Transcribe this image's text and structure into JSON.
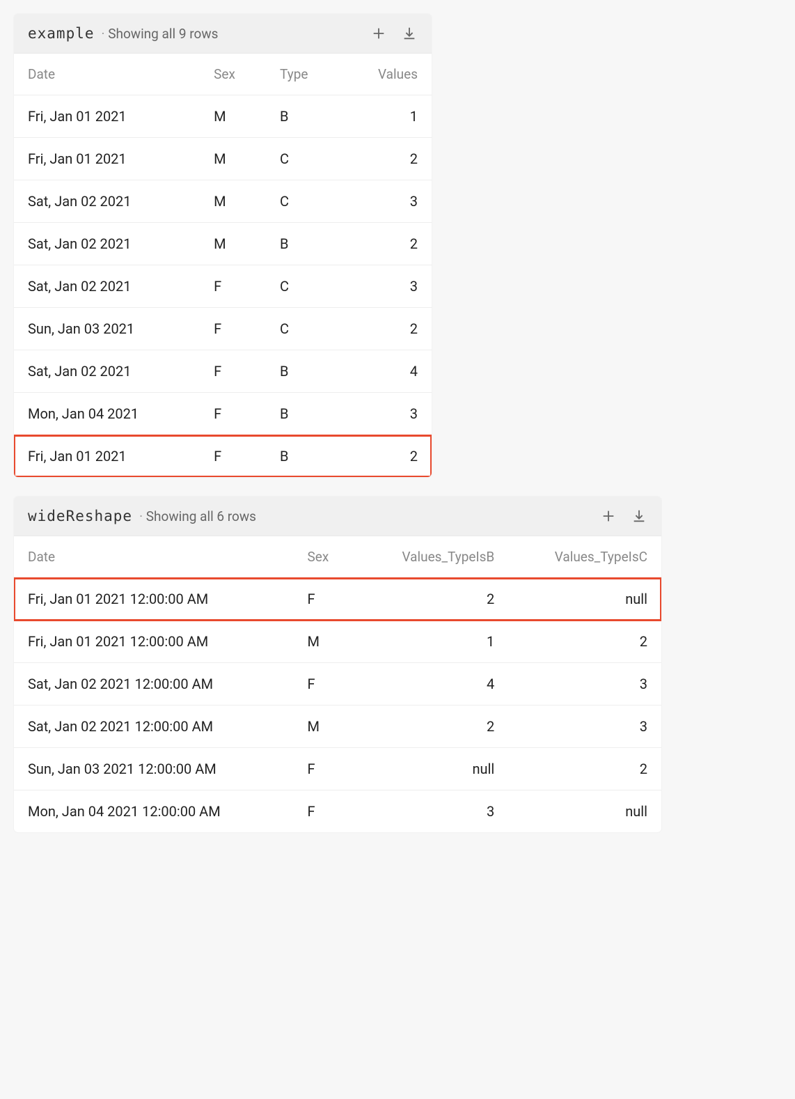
{
  "tables": [
    {
      "name": "example",
      "subtitle": "Showing all 9 rows",
      "columns": [
        {
          "label": "Date",
          "numeric": false
        },
        {
          "label": "Sex",
          "numeric": false
        },
        {
          "label": "Type",
          "numeric": false
        },
        {
          "label": "Values",
          "numeric": true
        }
      ],
      "rows": [
        {
          "cells": [
            "Fri, Jan 01 2021",
            "M",
            "B",
            "1"
          ],
          "highlight": false
        },
        {
          "cells": [
            "Fri, Jan 01 2021",
            "M",
            "C",
            "2"
          ],
          "highlight": false
        },
        {
          "cells": [
            "Sat, Jan 02 2021",
            "M",
            "C",
            "3"
          ],
          "highlight": false
        },
        {
          "cells": [
            "Sat, Jan 02 2021",
            "M",
            "B",
            "2"
          ],
          "highlight": false
        },
        {
          "cells": [
            "Sat, Jan 02 2021",
            "F",
            "C",
            "3"
          ],
          "highlight": false
        },
        {
          "cells": [
            "Sun, Jan 03 2021",
            "F",
            "C",
            "2"
          ],
          "highlight": false
        },
        {
          "cells": [
            "Sat, Jan 02 2021",
            "F",
            "B",
            "4"
          ],
          "highlight": false
        },
        {
          "cells": [
            "Mon, Jan 04 2021",
            "F",
            "B",
            "3"
          ],
          "highlight": false
        },
        {
          "cells": [
            "Fri, Jan 01 2021",
            "F",
            "B",
            "2"
          ],
          "highlight": true
        }
      ]
    },
    {
      "name": "wideReshape",
      "subtitle": "Showing all 6 rows",
      "columns": [
        {
          "label": "Date",
          "numeric": false
        },
        {
          "label": "Sex",
          "numeric": false
        },
        {
          "label": "Values_TypeIsB",
          "numeric": true
        },
        {
          "label": "Values_TypeIsC",
          "numeric": true
        }
      ],
      "rows": [
        {
          "cells": [
            "Fri, Jan 01 2021 12:00:00 AM",
            "F",
            "2",
            "null"
          ],
          "highlight": true
        },
        {
          "cells": [
            "Fri, Jan 01 2021 12:00:00 AM",
            "M",
            "1",
            "2"
          ],
          "highlight": false
        },
        {
          "cells": [
            "Sat, Jan 02 2021 12:00:00 AM",
            "F",
            "4",
            "3"
          ],
          "highlight": false
        },
        {
          "cells": [
            "Sat, Jan 02 2021 12:00:00 AM",
            "M",
            "2",
            "3"
          ],
          "highlight": false
        },
        {
          "cells": [
            "Sun, Jan 03 2021 12:00:00 AM",
            "F",
            "null",
            "2"
          ],
          "highlight": false
        },
        {
          "cells": [
            "Mon, Jan 04 2021 12:00:00 AM",
            "F",
            "3",
            "null"
          ],
          "highlight": false
        }
      ]
    }
  ],
  "icons": {
    "plus": "plus-icon",
    "download": "download-icon"
  }
}
